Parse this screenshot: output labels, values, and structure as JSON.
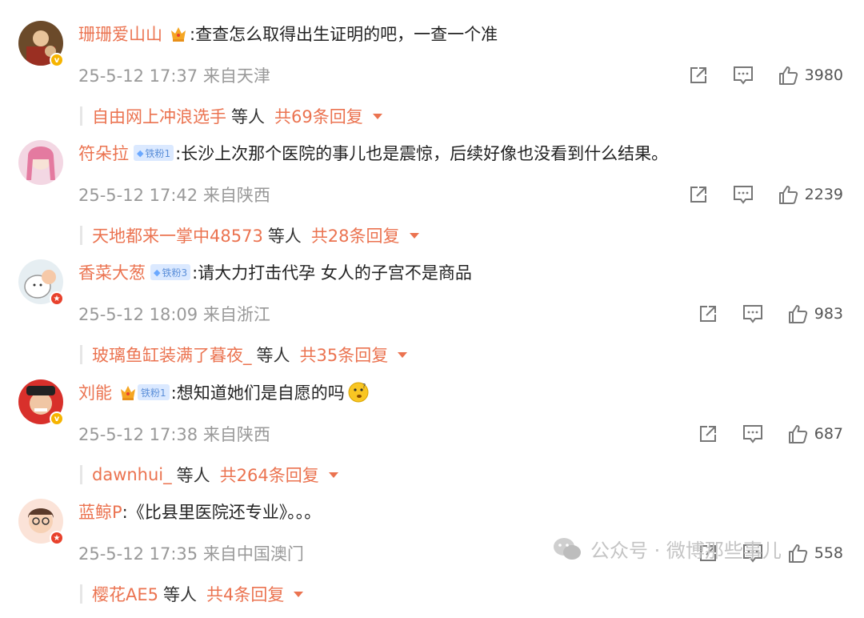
{
  "comments": [
    {
      "user": "珊珊爱山山",
      "badge": "crown",
      "fan_level": "",
      "text": ":查查怎么取得出生证明的吧，一查一个准",
      "timestamp": "25-5-12 17:37",
      "location": "来自天津",
      "likes": "3980",
      "reply_preview": {
        "name": "自由网上冲浪选手",
        "deng": "等人",
        "count": "共69条回复"
      },
      "verified": "gold"
    },
    {
      "user": "符朵拉",
      "badge": "fan",
      "fan_level": "铁粉1",
      "text": ":长沙上次那个医院的事儿也是震惊，后续好像也没看到什么结果。",
      "timestamp": "25-5-12 17:42",
      "location": "来自陕西",
      "likes": "2239",
      "reply_preview": {
        "name": "天地都来一掌中48573",
        "deng": "等人",
        "count": "共28条回复"
      },
      "verified": ""
    },
    {
      "user": "香菜大葱",
      "badge": "fan",
      "fan_level": "铁粉3",
      "text": ":请大力打击代孕 女人的子宫不是商品",
      "timestamp": "25-5-12 18:09",
      "location": "来自浙江",
      "likes": "983",
      "reply_preview": {
        "name": "玻璃鱼缸装满了暮夜_",
        "deng": "等人",
        "count": "共35条回复"
      },
      "verified": "red"
    },
    {
      "user": "刘能",
      "badge": "crown-fan",
      "fan_level": "铁粉1",
      "text": ":想知道她们是自愿的吗",
      "timestamp": "25-5-12 17:38",
      "location": "来自陕西",
      "likes": "687",
      "reply_preview": {
        "name": "dawnhui_",
        "deng": "等人",
        "count": "共264条回复"
      },
      "verified": "gold"
    },
    {
      "user": "蓝鲸P",
      "badge": "",
      "fan_level": "",
      "text": ":《比县里医院还专业》。。。",
      "timestamp": "25-5-12 17:35",
      "location": "来自中国澳门",
      "likes": "558",
      "reply_preview": {
        "name": "樱花AE5",
        "deng": "等人",
        "count": "共4条回复"
      },
      "verified": "red"
    }
  ],
  "watermark": {
    "text": "公众号 · 微博那些事儿"
  },
  "colors": {
    "accent": "#eb7350",
    "meta": "#999999",
    "text": "#222222"
  },
  "icons": {
    "share": "share-icon",
    "reply": "comment-icon",
    "like": "thumbs-up-icon"
  }
}
